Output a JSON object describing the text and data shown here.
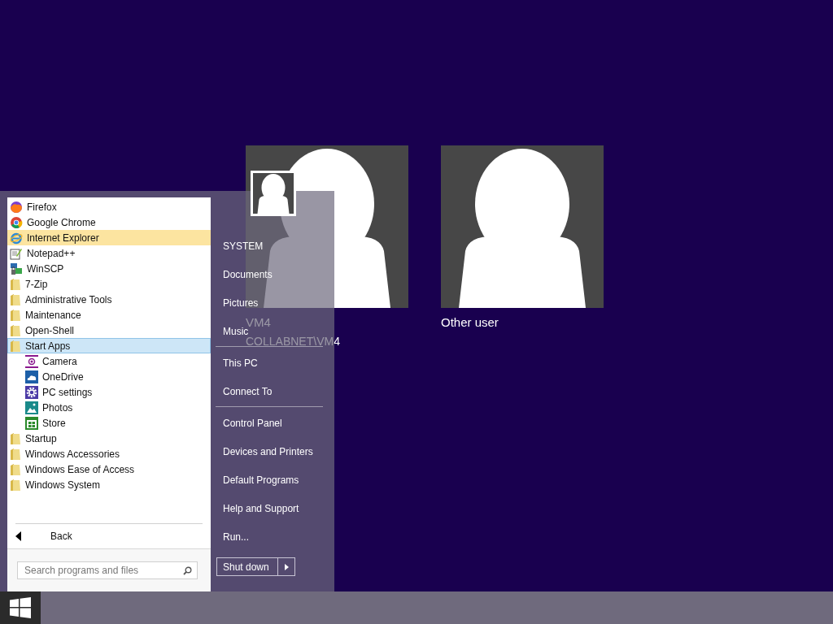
{
  "users": [
    {
      "name": "VM4",
      "account": "COLLABNET\\VM4"
    },
    {
      "name": "Other user"
    }
  ],
  "start_menu": {
    "programs": [
      {
        "label": "Firefox",
        "kind": "app",
        "highlighted": false
      },
      {
        "label": "Google Chrome",
        "kind": "app",
        "highlighted": false
      },
      {
        "label": "Internet Explorer",
        "kind": "app",
        "highlighted": true
      },
      {
        "label": "Notepad++",
        "kind": "app",
        "highlighted": false
      },
      {
        "label": "WinSCP",
        "kind": "app",
        "highlighted": false
      },
      {
        "label": "7-Zip",
        "kind": "folder",
        "highlighted": false,
        "expanded": false
      },
      {
        "label": "Administrative Tools",
        "kind": "folder",
        "highlighted": false,
        "expanded": false
      },
      {
        "label": "Maintenance",
        "kind": "folder",
        "highlighted": false,
        "expanded": false
      },
      {
        "label": "Open-Shell",
        "kind": "folder",
        "highlighted": false,
        "expanded": false
      },
      {
        "label": "Start Apps",
        "kind": "folder",
        "highlighted": false,
        "expanded": true,
        "children": [
          {
            "label": "Camera",
            "kind": "app",
            "highlighted": false
          },
          {
            "label": "OneDrive",
            "kind": "app",
            "highlighted": false
          },
          {
            "label": "PC settings",
            "kind": "app",
            "highlighted": false
          },
          {
            "label": "Photos",
            "kind": "app",
            "highlighted": false
          },
          {
            "label": "Store",
            "kind": "app",
            "highlighted": false
          }
        ]
      },
      {
        "label": "Startup",
        "kind": "folder",
        "highlighted": false,
        "expanded": false
      },
      {
        "label": "Windows Accessories",
        "kind": "folder",
        "highlighted": false,
        "expanded": false
      },
      {
        "label": "Windows Ease of Access",
        "kind": "folder",
        "highlighted": false,
        "expanded": false
      },
      {
        "label": "Windows System",
        "kind": "folder",
        "highlighted": false,
        "expanded": false
      }
    ],
    "back": {
      "label": "Back"
    },
    "search": {
      "placeholder": "Search programs and files"
    },
    "places": [
      [
        "SYSTEM",
        "Documents",
        "Pictures",
        "Music"
      ],
      [
        "This PC",
        "Connect To"
      ],
      [
        "Control Panel",
        "Devices and Printers",
        "Default Programs",
        "Help and Support",
        "Run..."
      ]
    ],
    "shutdown": {
      "label": "Shut down"
    }
  }
}
